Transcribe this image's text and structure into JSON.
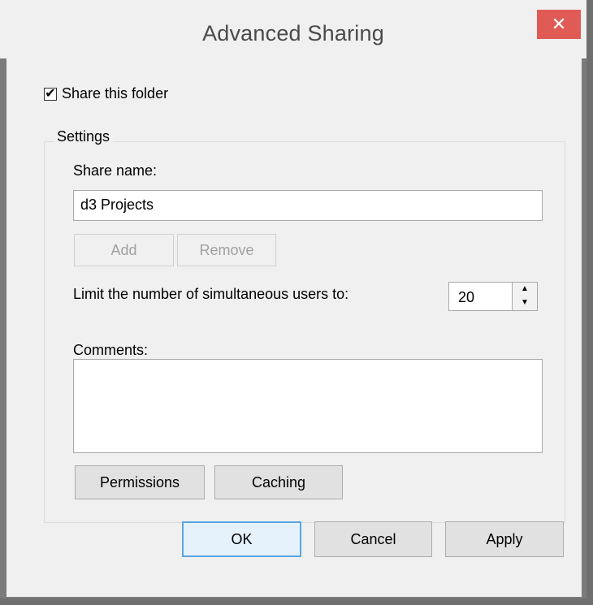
{
  "window": {
    "title": "Advanced Sharing",
    "close_glyph": "✕"
  },
  "share": {
    "checkbox_checked": true,
    "checkbox_glyph": "✔",
    "label": "Share this folder"
  },
  "settings": {
    "group_label": "Settings",
    "share_name_label": "Share name:",
    "share_name_value": "d3 Projects",
    "add_label": "Add",
    "remove_label": "Remove",
    "limit_label": "Limit the number of simultaneous users to:",
    "limit_value": "20",
    "spin_up": "▲",
    "spin_down": "▼",
    "comments_label": "Comments:",
    "comments_value": "",
    "permissions_label": "Permissions",
    "caching_label": "Caching"
  },
  "footer": {
    "ok_label": "OK",
    "cancel_label": "Cancel",
    "apply_label": "Apply"
  }
}
